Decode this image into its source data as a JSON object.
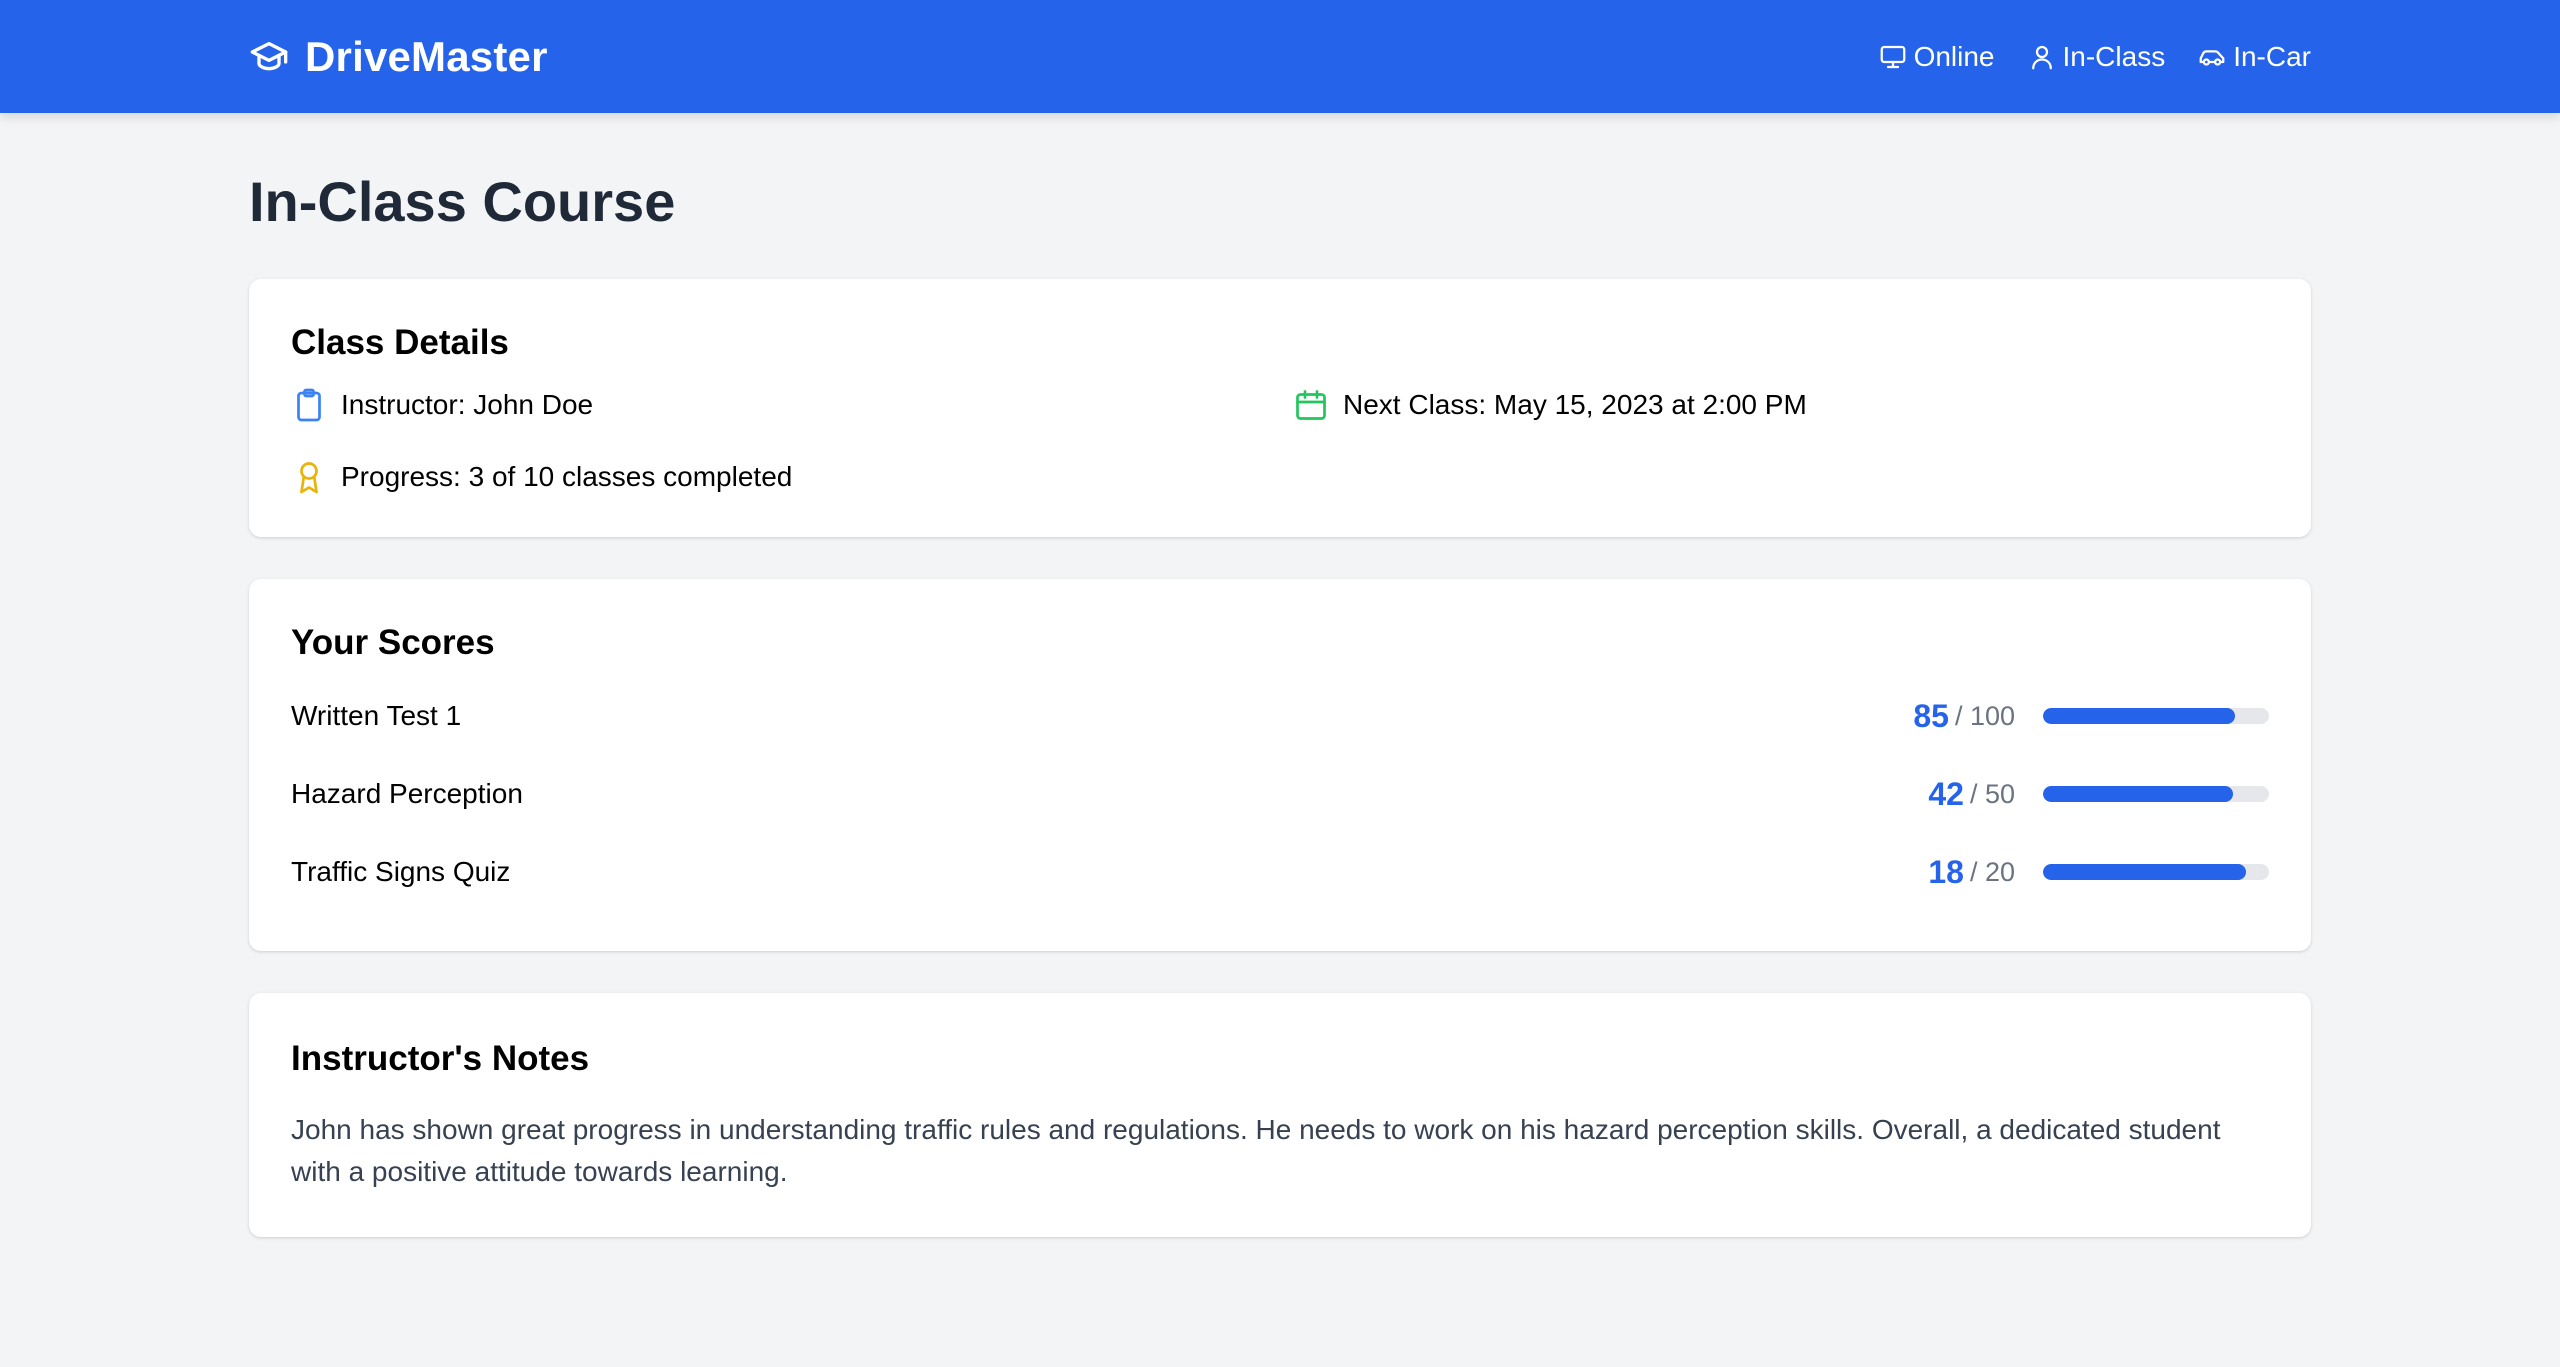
{
  "brand": {
    "name": "DriveMaster",
    "icon": "graduation-cap-icon"
  },
  "nav": {
    "items": [
      {
        "label": "Online",
        "icon": "monitor-icon"
      },
      {
        "label": "In-Class",
        "icon": "user-icon"
      },
      {
        "label": "In-Car",
        "icon": "car-icon"
      }
    ]
  },
  "page": {
    "title": "In-Class Course"
  },
  "details": {
    "title": "Class Details",
    "instructor": "Instructor: John Doe",
    "next_class": "Next Class: May 15, 2023 at 2:00 PM",
    "progress": "Progress: 3 of 10 classes completed"
  },
  "scores": {
    "title": "Your Scores",
    "items": [
      {
        "label": "Written Test 1",
        "value": "85",
        "max": "/ 100",
        "fraction": 0.85
      },
      {
        "label": "Hazard Perception",
        "value": "42",
        "max": "/ 50",
        "fraction": 0.84
      },
      {
        "label": "Traffic Signs Quiz",
        "value": "18",
        "max": "/ 20",
        "fraction": 0.9
      }
    ]
  },
  "notes": {
    "title": "Instructor's Notes",
    "text": "John has shown great progress in understanding traffic rules and regulations. He needs to work on his hazard perception skills. Overall, a dedicated student with a positive attitude towards learning."
  },
  "colors": {
    "primary": "#2563eb",
    "instructor_icon": "#3b82f6",
    "calendar_icon": "#22c55e",
    "award_icon": "#eab308",
    "background": "#f3f4f6"
  }
}
